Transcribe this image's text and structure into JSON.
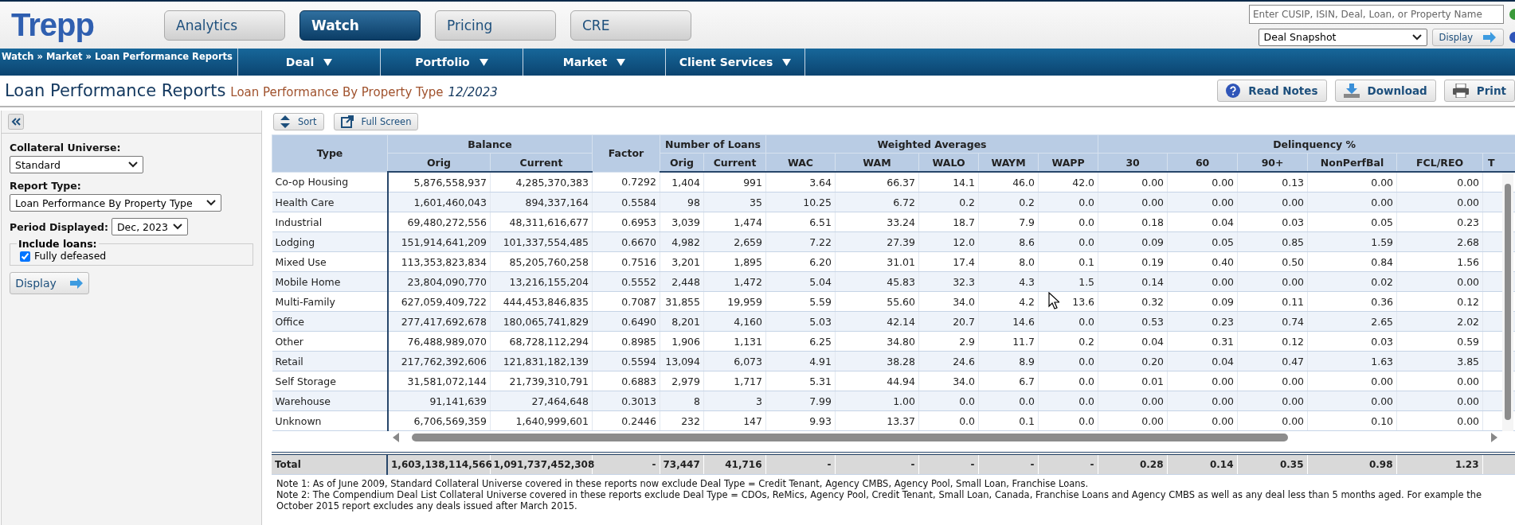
{
  "header": {
    "logo": "Trepp",
    "modules": [
      {
        "label": "Analytics",
        "selected": false
      },
      {
        "label": "Watch",
        "selected": true
      },
      {
        "label": "Pricing",
        "selected": false
      },
      {
        "label": "CRE",
        "selected": false
      }
    ],
    "search": {
      "placeholder": "Enter CUSIP, ISIN, Deal, Loan, or Property Name"
    },
    "view_select": {
      "value": "Deal Snapshot"
    },
    "display_button": "Display"
  },
  "nav": {
    "breadcrumb": "Watch » Market » Loan Performance Reports",
    "menus": [
      "Deal",
      "Portfolio",
      "Market",
      "Client Services"
    ]
  },
  "page": {
    "title": "Loan Performance Reports",
    "subtitle": "Loan Performance By Property Type",
    "period": "12/2023",
    "actions": [
      {
        "kind": "help",
        "label": "Read Notes"
      },
      {
        "kind": "download",
        "label": "Download"
      },
      {
        "kind": "print",
        "label": "Print"
      }
    ]
  },
  "sidebar": {
    "fields": [
      {
        "kind": "select",
        "label": "Collateral Universe:",
        "value": "Standard"
      },
      {
        "kind": "select",
        "label": "Report Type:",
        "value": "Loan Performance By Property Type"
      },
      {
        "kind": "inline-select",
        "label": "Period Displayed:",
        "value": "Dec, 2023"
      }
    ],
    "include_loans": {
      "legend": "Include loans:",
      "options": [
        {
          "label": "Fully defeased",
          "checked": true
        }
      ]
    },
    "display_button": "Display"
  },
  "table": {
    "toolbar": [
      {
        "kind": "sort",
        "label": "Sort"
      },
      {
        "kind": "fullscreen",
        "label": "Full Screen"
      }
    ],
    "groups": [
      {
        "label": "Type"
      },
      {
        "label": "Balance",
        "columns": [
          "Orig",
          "Current"
        ]
      },
      {
        "label": "Factor"
      },
      {
        "label": "Number of Loans",
        "columns": [
          "Orig",
          "Current"
        ]
      },
      {
        "label": "Weighted Averages",
        "columns": [
          "WAC",
          "WAM",
          "WALO",
          "WAYM",
          "WAPP"
        ]
      },
      {
        "label": "Delinquency %",
        "columns": [
          "30",
          "60",
          "90+",
          "NonPerfBal",
          "FCL/REO",
          "T"
        ]
      }
    ],
    "rows": [
      {
        "type": "Co-op Housing",
        "values": [
          "5,876,558,937",
          "4,285,370,383",
          "0.7292",
          "1,404",
          "991",
          "3.64",
          "66.37",
          "14.1",
          "46.0",
          "42.0",
          "0.00",
          "0.00",
          "0.13",
          "0.00",
          "0.00"
        ]
      },
      {
        "type": "Health Care",
        "values": [
          "1,601,460,043",
          "894,337,164",
          "0.5584",
          "98",
          "35",
          "10.25",
          "6.72",
          "0.2",
          "0.2",
          "0.0",
          "0.00",
          "0.00",
          "0.00",
          "0.00",
          "0.00"
        ]
      },
      {
        "type": "Industrial",
        "values": [
          "69,480,272,556",
          "48,311,616,677",
          "0.6953",
          "3,039",
          "1,474",
          "6.51",
          "33.24",
          "18.7",
          "7.9",
          "0.0",
          "0.18",
          "0.04",
          "0.03",
          "0.05",
          "0.23"
        ]
      },
      {
        "type": "Lodging",
        "values": [
          "151,914,641,209",
          "101,337,554,485",
          "0.6670",
          "4,982",
          "2,659",
          "7.22",
          "27.39",
          "12.0",
          "8.6",
          "0.0",
          "0.09",
          "0.05",
          "0.85",
          "1.59",
          "2.68"
        ]
      },
      {
        "type": "Mixed Use",
        "values": [
          "113,353,823,834",
          "85,205,760,258",
          "0.7516",
          "3,201",
          "1,895",
          "6.20",
          "31.01",
          "17.4",
          "8.0",
          "0.1",
          "0.19",
          "0.40",
          "0.50",
          "0.84",
          "1.56"
        ]
      },
      {
        "type": "Mobile Home",
        "values": [
          "23,804,090,770",
          "13,216,155,204",
          "0.5552",
          "2,448",
          "1,472",
          "5.04",
          "45.83",
          "32.3",
          "4.3",
          "1.5",
          "0.14",
          "0.00",
          "0.00",
          "0.02",
          "0.00"
        ]
      },
      {
        "type": "Multi-Family",
        "values": [
          "627,059,409,722",
          "444,453,846,835",
          "0.7087",
          "31,855",
          "19,959",
          "5.59",
          "55.60",
          "34.0",
          "4.2",
          "13.6",
          "0.32",
          "0.09",
          "0.11",
          "0.36",
          "0.12"
        ]
      },
      {
        "type": "Office",
        "values": [
          "277,417,692,678",
          "180,065,741,829",
          "0.6490",
          "8,201",
          "4,160",
          "5.03",
          "42.14",
          "20.7",
          "14.6",
          "0.0",
          "0.53",
          "0.23",
          "0.74",
          "2.65",
          "2.02"
        ]
      },
      {
        "type": "Other",
        "values": [
          "76,488,989,070",
          "68,728,112,294",
          "0.8985",
          "1,906",
          "1,131",
          "6.25",
          "34.80",
          "2.9",
          "11.7",
          "0.2",
          "0.04",
          "0.31",
          "0.12",
          "0.03",
          "0.59"
        ]
      },
      {
        "type": "Retail",
        "values": [
          "217,762,392,606",
          "121,831,182,139",
          "0.5594",
          "13,094",
          "6,073",
          "4.91",
          "38.28",
          "24.6",
          "8.9",
          "0.0",
          "0.20",
          "0.04",
          "0.47",
          "1.63",
          "3.85"
        ]
      },
      {
        "type": "Self Storage",
        "values": [
          "31,581,072,144",
          "21,739,310,791",
          "0.6883",
          "2,979",
          "1,717",
          "5.31",
          "44.94",
          "34.0",
          "6.7",
          "0.0",
          "0.01",
          "0.00",
          "0.00",
          "0.00",
          "0.00"
        ]
      },
      {
        "type": "Warehouse",
        "values": [
          "91,141,639",
          "27,464,648",
          "0.3013",
          "8",
          "3",
          "7.99",
          "1.00",
          "0.0",
          "0.0",
          "0.0",
          "0.00",
          "0.00",
          "0.00",
          "0.00",
          "0.00"
        ]
      },
      {
        "type": "Unknown",
        "values": [
          "6,706,569,359",
          "1,640,999,601",
          "0.2446",
          "232",
          "147",
          "9.93",
          "13.37",
          "0.0",
          "0.1",
          "0.0",
          "0.00",
          "0.00",
          "0.00",
          "0.10",
          "0.00"
        ]
      }
    ],
    "total": {
      "label": "Total",
      "values": [
        "1,603,138,114,566",
        "1,091,737,452,308",
        "-",
        "73,447",
        "41,716",
        "-",
        "-",
        "-",
        "-",
        "-",
        "0.28",
        "0.14",
        "0.35",
        "0.98",
        "1.23"
      ]
    },
    "notes": [
      "Note 1: As of June 2009, Standard Collateral Universe covered in these reports now exclude Deal Type = Credit Tenant, Agency CMBS, Agency Pool, Small Loan, Franchise Loans.",
      "Note 2: The Compendium Deal List Collateral Universe covered in these reports exclude Deal Type = CDOs, ReMics, Agency Pool, Credit Tenant, Small Loan, Canada, Franchise Loans and Agency CMBS as well as any deal less than 5 months aged. For example the October 2015 report excludes any deals issued after March 2015."
    ]
  }
}
